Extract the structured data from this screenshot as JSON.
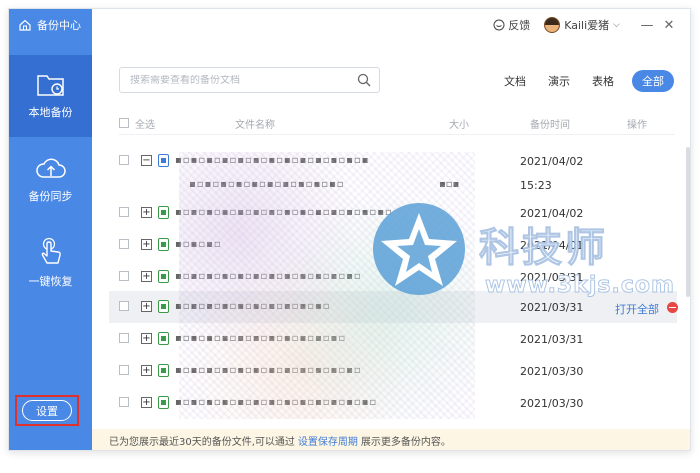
{
  "app": {
    "title": "备份中心"
  },
  "sidebar": {
    "items": [
      {
        "label": "本地备份",
        "icon": "folder-clock-icon",
        "active": true
      },
      {
        "label": "备份同步",
        "icon": "cloud-upload-icon",
        "active": false
      },
      {
        "label": "一键恢复",
        "icon": "hand-tap-icon",
        "active": false
      }
    ],
    "settings_label": "设置"
  },
  "titlebar": {
    "feedback_label": "反馈",
    "user_name": "Kaili爱猪",
    "min_symbol": "—",
    "close_symbol": "✕"
  },
  "search": {
    "placeholder": "搜索需要查看的备份文档"
  },
  "filters": [
    "文档",
    "演示",
    "表格",
    "全部"
  ],
  "active_filter": "全部",
  "table": {
    "headers": {
      "select_all": "全选",
      "name": "文件名称",
      "size": "大小",
      "time": "备份时间",
      "action": "操作"
    },
    "rows": [
      {
        "expand": "−",
        "type": "doc",
        "name": "▪▫▪▫▪▫▪▫▪▫▪▫▪▫▪▫▪▫▪▫▪▫▪▫▪",
        "size": "",
        "date": "2021/04/02",
        "action": ""
      },
      {
        "expand": "",
        "type": "",
        "name": "▪▫▪▫▪▫▪▫▪▫▪▫▪▫▪▫▪▫▪▫",
        "size": "▪▫▪",
        "date": "15:23",
        "action": ""
      },
      {
        "expand": "+",
        "type": "xls",
        "name": "▪▫▪▫▪▫▪▫▪▫▪▫▪▫▪▫▪▫▪▫▪▫▪▫▪▫▪▫",
        "size": "",
        "date": "2021/04/02",
        "action": ""
      },
      {
        "expand": "+",
        "type": "xls",
        "name": "▪▫▪▫▪▫",
        "size": "",
        "date": "2021/04/01",
        "action": ""
      },
      {
        "expand": "+",
        "type": "xls",
        "name": "▪▫▪▫▪▫▪▫▪▫▪▫▪▫▪▫▪▫▪▫▪▫▪▫",
        "size": "",
        "date": "2021/03/31",
        "action": ""
      },
      {
        "expand": "+",
        "type": "xls",
        "name": "▪▫▪▫▪▫▪▫▪▫▪▫▪▫▪▫▪▫▪▫",
        "size": "",
        "date": "2021/03/31",
        "action": "打开全部",
        "highlight": true
      },
      {
        "expand": "+",
        "type": "xls",
        "name": "▪▫▪▫▪▫▪▫▪▫▪▫▪▫▪▫▪▫▪▫▪▫",
        "size": "",
        "date": "2021/03/31",
        "action": ""
      },
      {
        "expand": "+",
        "type": "xls",
        "name": "▪▫▪▫▪▫▪▫▪▫▪▫▪▫▪▫▪▫▪▫▪▫▪▫",
        "size": "",
        "date": "2021/03/30",
        "action": ""
      },
      {
        "expand": "+",
        "type": "xls",
        "name": "▪▫▪▫▪▫▪▫▪▫▪▫▪▫▪▫▪▫▪▫▪▫▪▫▪▫",
        "size": "",
        "date": "2021/03/30",
        "action": ""
      }
    ]
  },
  "footer": {
    "prefix": "已为您展示最近30天的备份文件,可以通过",
    "link": "设置保存周期",
    "suffix": "展示更多备份内容。"
  },
  "watermark": {
    "text": "科技师",
    "url": "www.3kjs.com"
  },
  "colors": {
    "sidebar": "#4a88e6",
    "sidebar_active": "#356fd1",
    "accent": "#3f7bd6",
    "danger": "#e84545",
    "footer_bg": "#fdf6e4"
  }
}
